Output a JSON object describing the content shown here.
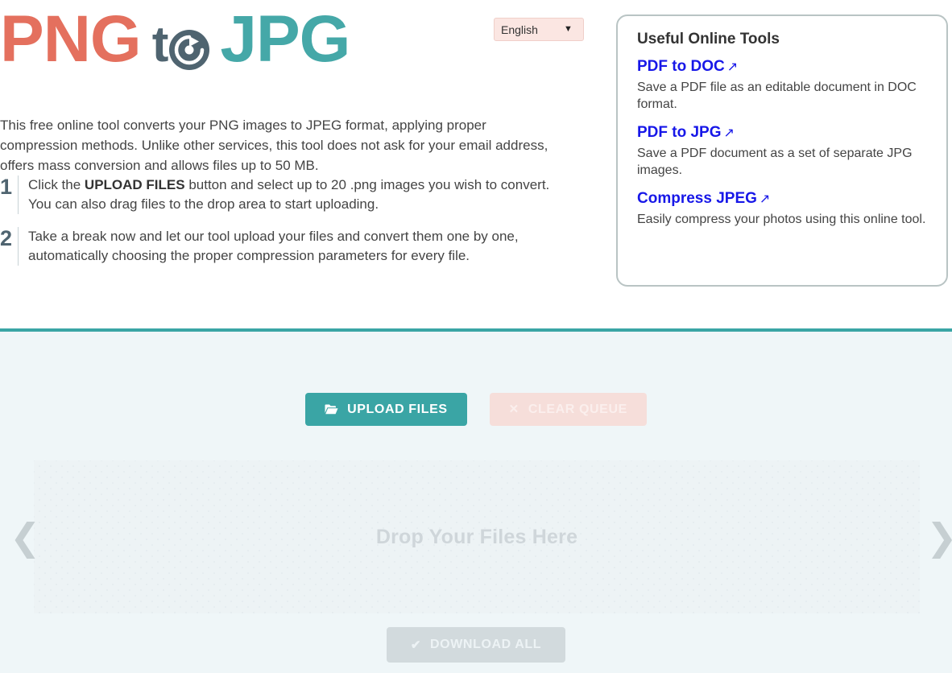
{
  "logo": {
    "part1": "PNG",
    "part2": "t",
    "o_icon": "rotate-arrow-icon",
    "part3": "JPG",
    "colors": {
      "png": "#E4705E",
      "to": "#4F6470",
      "jpg": "#45A8A8"
    }
  },
  "language": {
    "selected": "English",
    "options": [
      "English"
    ],
    "caret_icon": "chevron-down-icon"
  },
  "description": "This free online tool converts your PNG images to JPEG format, applying proper compression methods. Unlike other services, this tool does not ask for your email address, offers mass conversion and allows files up to 50 MB.",
  "steps": [
    {
      "number": "1",
      "text_before": "Click the ",
      "text_bold": "UPLOAD FILES",
      "text_after": " button and select up to 20 .png images you wish to convert. You can also drag files to the drop area to start uploading."
    },
    {
      "number": "2",
      "text_before": "",
      "text_bold": "",
      "text_after": "Take a break now and let our tool upload your files and convert them one by one, automatically choosing the proper compression parameters for every file."
    }
  ],
  "tools_panel": {
    "title": "Useful Online Tools",
    "external_arrow": "↗",
    "items": [
      {
        "link": "PDF to DOC",
        "description": "Save a PDF file as an editable document in DOC format."
      },
      {
        "link": "PDF to JPG",
        "description": "Save a PDF document as a set of separate JPG images."
      },
      {
        "link": "Compress JPEG",
        "description": "Easily compress your photos using this online tool."
      }
    ],
    "link_color": "#1717E8"
  },
  "workspace": {
    "upload_button": {
      "label": "UPLOAD FILES",
      "icon": "folder-open-icon",
      "color": "#3AA5A5"
    },
    "clear_button": {
      "label": "CLEAR QUEUE",
      "icon": "close-x-icon",
      "color": "#F6DEDA",
      "state": "disabled"
    },
    "drop_area": {
      "text": "Drop Your Files Here"
    },
    "carousel": {
      "prev_icon": "chevron-left-icon",
      "next_icon": "chevron-right-icon",
      "prev_glyph": "❮",
      "next_glyph": "❯"
    },
    "download_button": {
      "label": "DOWNLOAD ALL",
      "icon": "check-icon",
      "glyph": "✔",
      "color": "#D2DADD",
      "state": "disabled"
    },
    "divider_color": "#3AA5A5",
    "background_color": "#EFF6F8"
  }
}
